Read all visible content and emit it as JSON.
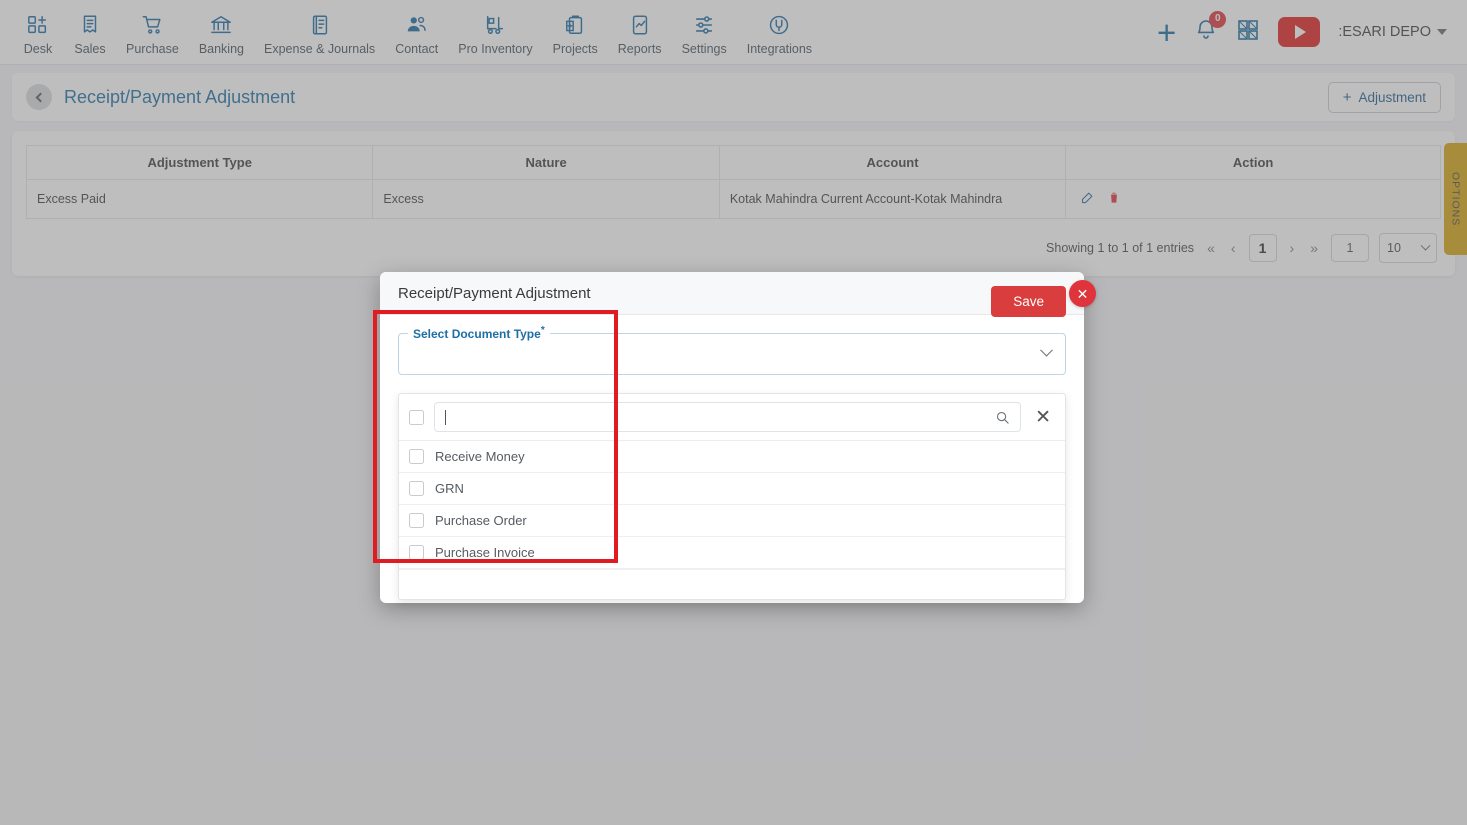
{
  "topnav": {
    "items": [
      {
        "label": "Desk",
        "icon": "desk-grid-plus-icon"
      },
      {
        "label": "Sales",
        "icon": "sales-receipt-icon"
      },
      {
        "label": "Purchase",
        "icon": "purchase-cart-icon"
      },
      {
        "label": "Banking",
        "icon": "banking-bank-icon"
      },
      {
        "label": "Expense & Journals",
        "icon": "expense-journal-icon"
      },
      {
        "label": "Contact",
        "icon": "contact-people-icon"
      },
      {
        "label": "Pro Inventory",
        "icon": "pro-inventory-forklift-icon"
      },
      {
        "label": "Projects",
        "icon": "projects-clipboard-icon"
      },
      {
        "label": "Reports",
        "icon": "reports-chart-icon"
      },
      {
        "label": "Settings",
        "icon": "settings-sliders-icon"
      },
      {
        "label": "Integrations",
        "icon": "integrations-plug-icon"
      }
    ],
    "add_label": "+",
    "notification_count": "0",
    "user_name": ":ESARI DEPO"
  },
  "page_header": {
    "title": "Receipt/Payment Adjustment",
    "add_button": "Adjustment",
    "add_button_plus": "+"
  },
  "table": {
    "headers": [
      "Adjustment Type",
      "Nature",
      "Account",
      "Action"
    ],
    "rows": [
      {
        "adjustment_type": "Excess Paid",
        "nature": "Excess",
        "account": "Kotak Mahindra Current Account-Kotak Mahindra"
      }
    ],
    "pager": {
      "showing": "Showing 1 to 1 of 1 entries",
      "first": "«",
      "prev": "‹",
      "current_page": "1",
      "next": "›",
      "last": "»",
      "goto_value": "1",
      "page_size": "10"
    }
  },
  "options_tab": {
    "label": "OPTIONS"
  },
  "modal": {
    "title": "Receipt/Payment Adjustment",
    "close_label": "✕",
    "field": {
      "legend": "Select Document Type",
      "required_mark": "*",
      "value": ""
    },
    "dropdown": {
      "search_value": "",
      "search_placeholder": "",
      "clear_label": "✕",
      "options": [
        {
          "label": "Receive Money",
          "checked": false
        },
        {
          "label": "GRN",
          "checked": false
        },
        {
          "label": "Purchase Order",
          "checked": false
        },
        {
          "label": "Purchase Invoice",
          "checked": false
        }
      ]
    },
    "save_button": "Save"
  },
  "colors": {
    "brand_blue": "#1a6ba5",
    "accent_red": "#e0343c",
    "options_gold": "#d6a412",
    "annotation_red": "#e01b22",
    "field_border_blue": "#bcd6e8"
  }
}
